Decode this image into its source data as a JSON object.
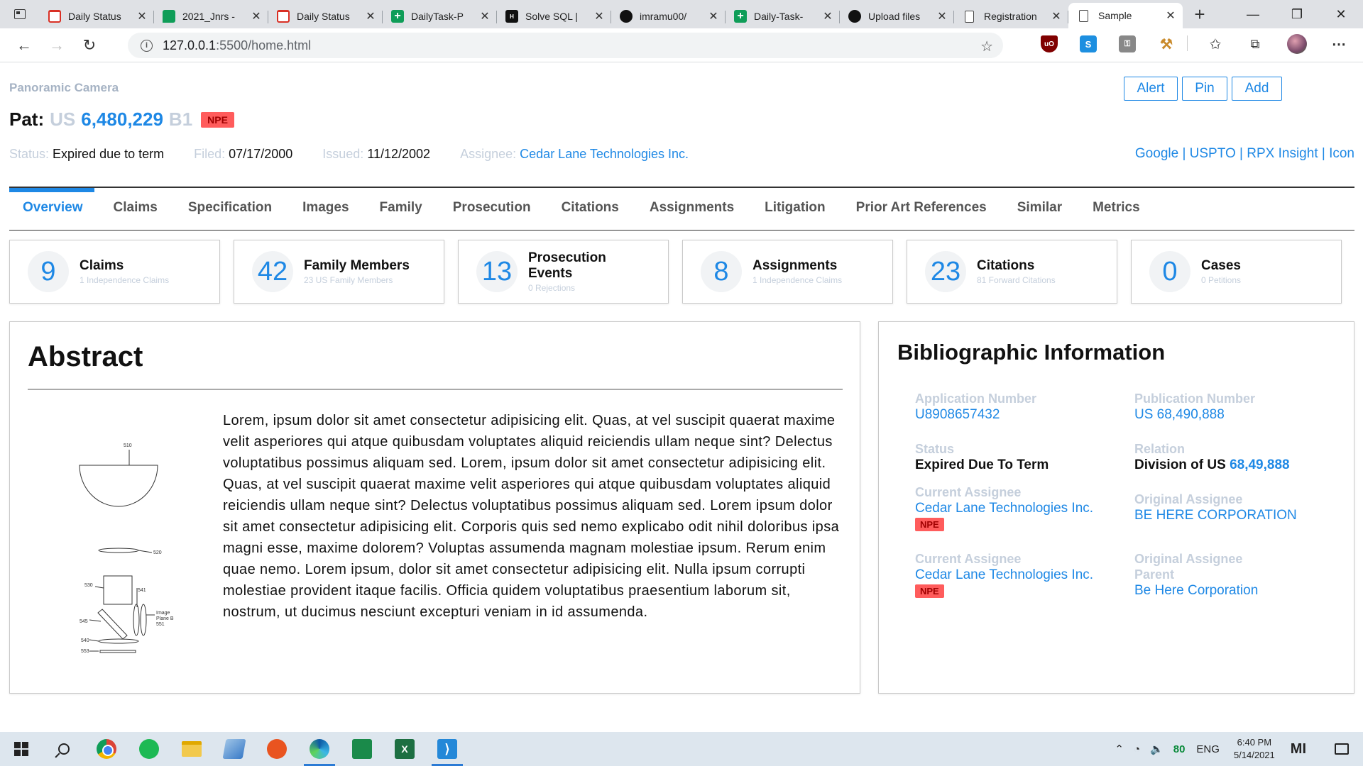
{
  "browser": {
    "tabs": [
      {
        "title": "Daily Status",
        "icon": "gmail-icon",
        "icon_glyph": ""
      },
      {
        "title": "2021_Jnrs -",
        "icon": "google-chat-icon",
        "icon_glyph": ""
      },
      {
        "title": "Daily Status",
        "icon": "gmail-icon",
        "icon_glyph": ""
      },
      {
        "title": "DailyTask-P",
        "icon": "sheets-icon",
        "icon_glyph": ""
      },
      {
        "title": "Solve SQL |",
        "icon": "hackerrank-icon",
        "icon_glyph": "H"
      },
      {
        "title": "imramu00/",
        "icon": "github-icon",
        "icon_glyph": ""
      },
      {
        "title": "Daily-Task-",
        "icon": "sheets-icon",
        "icon_glyph": ""
      },
      {
        "title": "Upload files",
        "icon": "github-icon",
        "icon_glyph": ""
      },
      {
        "title": "Registration",
        "icon": "document-icon",
        "icon_glyph": ""
      },
      {
        "title": "Sample",
        "icon": "document-icon",
        "icon_glyph": ""
      }
    ],
    "url_host": "127.0.0.1",
    "url_path": ":5500/home.html",
    "close_glyph": "✕",
    "new_tab_glyph": "+",
    "back_glyph": "←",
    "forward_glyph": "→",
    "reload_glyph": "↻",
    "minimize_glyph": "—",
    "restore_glyph": "❐",
    "window_close_glyph": "✕",
    "info_glyph": "i",
    "star_glyph": "☆",
    "ext_ublock": "uO",
    "ext_skype": "S",
    "ext_lock": "⚿",
    "ext_hammer": "⚒",
    "favorites_glyph": "✩",
    "collections_glyph": "⧉",
    "more_glyph": "⋯"
  },
  "header": {
    "subtitle": "Panoramic Camera",
    "pat_label": "Pat:",
    "pat_country": "US",
    "pat_number": "6,480,229",
    "pat_kind": "B1",
    "npe_badge": "NPE",
    "status_key": "Status:",
    "status_val": "Expired due to term",
    "filed_key": "Filed:",
    "filed_val": "07/17/2000",
    "issued_key": "Issued:",
    "issued_val": "11/12/2002",
    "assignee_key": "Assignee:",
    "assignee_val": "Cedar Lane Technologies Inc.",
    "external_links": "Google | USPTO | RPX Insight | Icon",
    "actions": {
      "alert": "Alert",
      "pin": "Pin",
      "add": "Add"
    }
  },
  "section_tabs": [
    "Overview",
    "Claims",
    "Specification",
    "Images",
    "Family",
    "Prosecution",
    "Citations",
    "Assignments",
    "Litigation",
    "Prior Art References",
    "Similar",
    "Metrics"
  ],
  "stats": [
    {
      "value": "9",
      "title": "Claims",
      "sub": "1 Independence Claims"
    },
    {
      "value": "42",
      "title": "Family Members",
      "sub": "23 US Family Members"
    },
    {
      "value": "13",
      "title": "Prosecution Events",
      "sub": "0 Rejections"
    },
    {
      "value": "8",
      "title": "Assignments",
      "sub": "1 Independence Claims"
    },
    {
      "value": "23",
      "title": "Citations",
      "sub": "81 Forward Citations"
    },
    {
      "value": "0",
      "title": "Cases",
      "sub": "0 Petitions"
    }
  ],
  "abstract": {
    "title": "Abstract",
    "text": "Lorem, ipsum dolor sit amet consectetur adipisicing elit. Quas, at vel suscipit quaerat maxime velit asperiores qui atque quibusdam voluptates aliquid reiciendis ullam neque sint? Delectus voluptatibus possimus aliquam sed. Lorem, ipsum dolor sit amet consectetur adipisicing elit. Quas, at vel suscipit quaerat maxime velit asperiores qui atque quibusdam voluptates aliquid reiciendis ullam neque sint? Delectus voluptatibus possimus aliquam sed. Lorem ipsum dolor sit amet consectetur adipisicing elit. Corporis quis sed nemo explicabo odit nihil doloribus ipsa magni esse, maxime dolorem? Voluptas assumenda magnam molestiae ipsum. Rerum enim quae nemo. Lorem ipsum, dolor sit amet consectetur adipisicing elit. Nulla ipsum corrupti molestiae provident itaque facilis. Officia quidem voluptatibus praesentium laborum sit, nostrum, ut ducimus nesciunt excepturi veniam in id assumenda.",
    "figure_labels": {
      "l510": "510",
      "l520": "520",
      "l530": "530",
      "l541": "541",
      "image_plane_1": "Image",
      "image_plane_2": "Plane B",
      "image_plane_3": "551",
      "l545": "545",
      "l540": "540",
      "l553": "553"
    }
  },
  "biblio": {
    "title": "Bibliographic Information",
    "application_number_label": "Application Number",
    "application_number": "U8908657432",
    "publication_number_label": "Publication Number",
    "publication_number": "US 68,490,888",
    "status_label": "Status",
    "status": "Expired Due To Term",
    "relation_label": "Relation",
    "relation_text": "Division of US",
    "relation_link": "68,49,888",
    "current_assignee_label": "Current Assignee",
    "current_assignee": "Cedar Lane Technologies Inc.",
    "original_assignee_label": "Original Assignee",
    "original_assignee": "BE HERE CORPORATION",
    "current_assignee_label_2": "Current Assignee",
    "current_assignee_2": "Cedar Lane Technologies Inc.",
    "original_assignee_parent_label": "Original Assignee Parent",
    "original_assignee_parent": "Be Here Corporation",
    "npe": "NPE"
  },
  "taskbar": {
    "battery": "80",
    "lang": "ENG",
    "time": "6:40 PM",
    "date": "5/14/2021",
    "excel_glyph": "X",
    "vscode_glyph": "⟩",
    "chevron_glyph": "⌃",
    "wifi_glyph": "◔",
    "volume_glyph": "🔈",
    "mi_glyph": "MI"
  },
  "colors": {
    "accent": "#1e88e5",
    "npe_bg": "#ff5c5c",
    "muted_label": "#c5cfdc"
  }
}
